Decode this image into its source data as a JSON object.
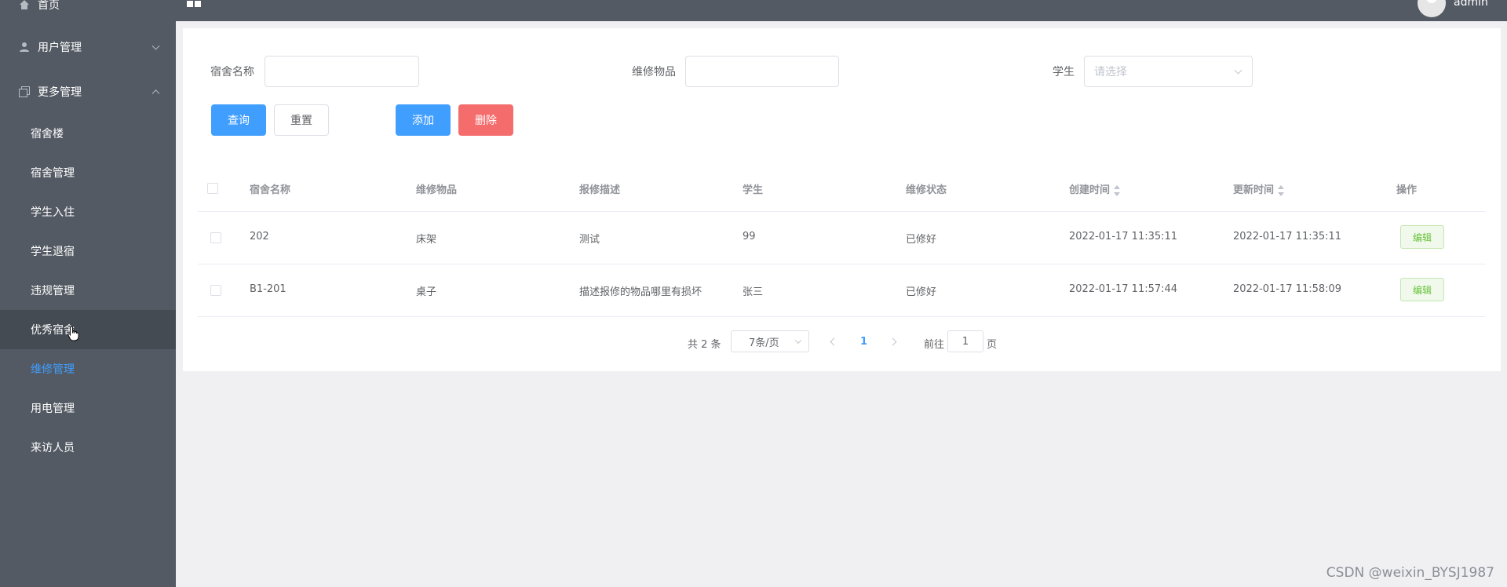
{
  "sidebar": {
    "home_label": "首页",
    "user_mgmt_label": "用户管理",
    "more_mgmt_label": "更多管理",
    "sub_items": [
      {
        "label": "宿舍楼"
      },
      {
        "label": "宿舍管理"
      },
      {
        "label": "学生入住"
      },
      {
        "label": "学生退宿"
      },
      {
        "label": "违规管理"
      },
      {
        "label": "优秀宿舍"
      },
      {
        "label": "维修管理"
      },
      {
        "label": "用电管理"
      },
      {
        "label": "来访人员"
      }
    ],
    "active_item": "维修管理",
    "active_color": "#409eff"
  },
  "header": {
    "username": "admin"
  },
  "filters": {
    "dorm_name_label": "宿舍名称",
    "dorm_name_value": "",
    "item_label": "维修物品",
    "item_value": "",
    "student_label": "学生",
    "student_placeholder": "请选择"
  },
  "actions": {
    "query": "查询",
    "reset": "重置",
    "add": "添加",
    "delete": "删除"
  },
  "table": {
    "columns": [
      "宿舍名称",
      "维修物品",
      "报修描述",
      "学生",
      "维修状态",
      "创建时间",
      "更新时间",
      "操作"
    ],
    "rows": [
      {
        "dorm": "202",
        "item": "床架",
        "desc": "测试",
        "student": "99",
        "status": "已修好",
        "created": "2022-01-17 11:35:11",
        "updated": "2022-01-17 11:35:11",
        "action": "编辑"
      },
      {
        "dorm": "B1-201",
        "item": "桌子",
        "desc": "描述报修的物品哪里有损坏",
        "student": "张三",
        "status": "已修好",
        "created": "2022-01-17 11:57:44",
        "updated": "2022-01-17 11:58:09",
        "action": "编辑"
      }
    ]
  },
  "pagination": {
    "total_text": "共 2 条",
    "page_size": "7条/页",
    "current_page": "1",
    "goto_label": "前往",
    "goto_value": "1",
    "page_unit": "页"
  },
  "watermark": "CSDN @weixin_BYSJ1987"
}
